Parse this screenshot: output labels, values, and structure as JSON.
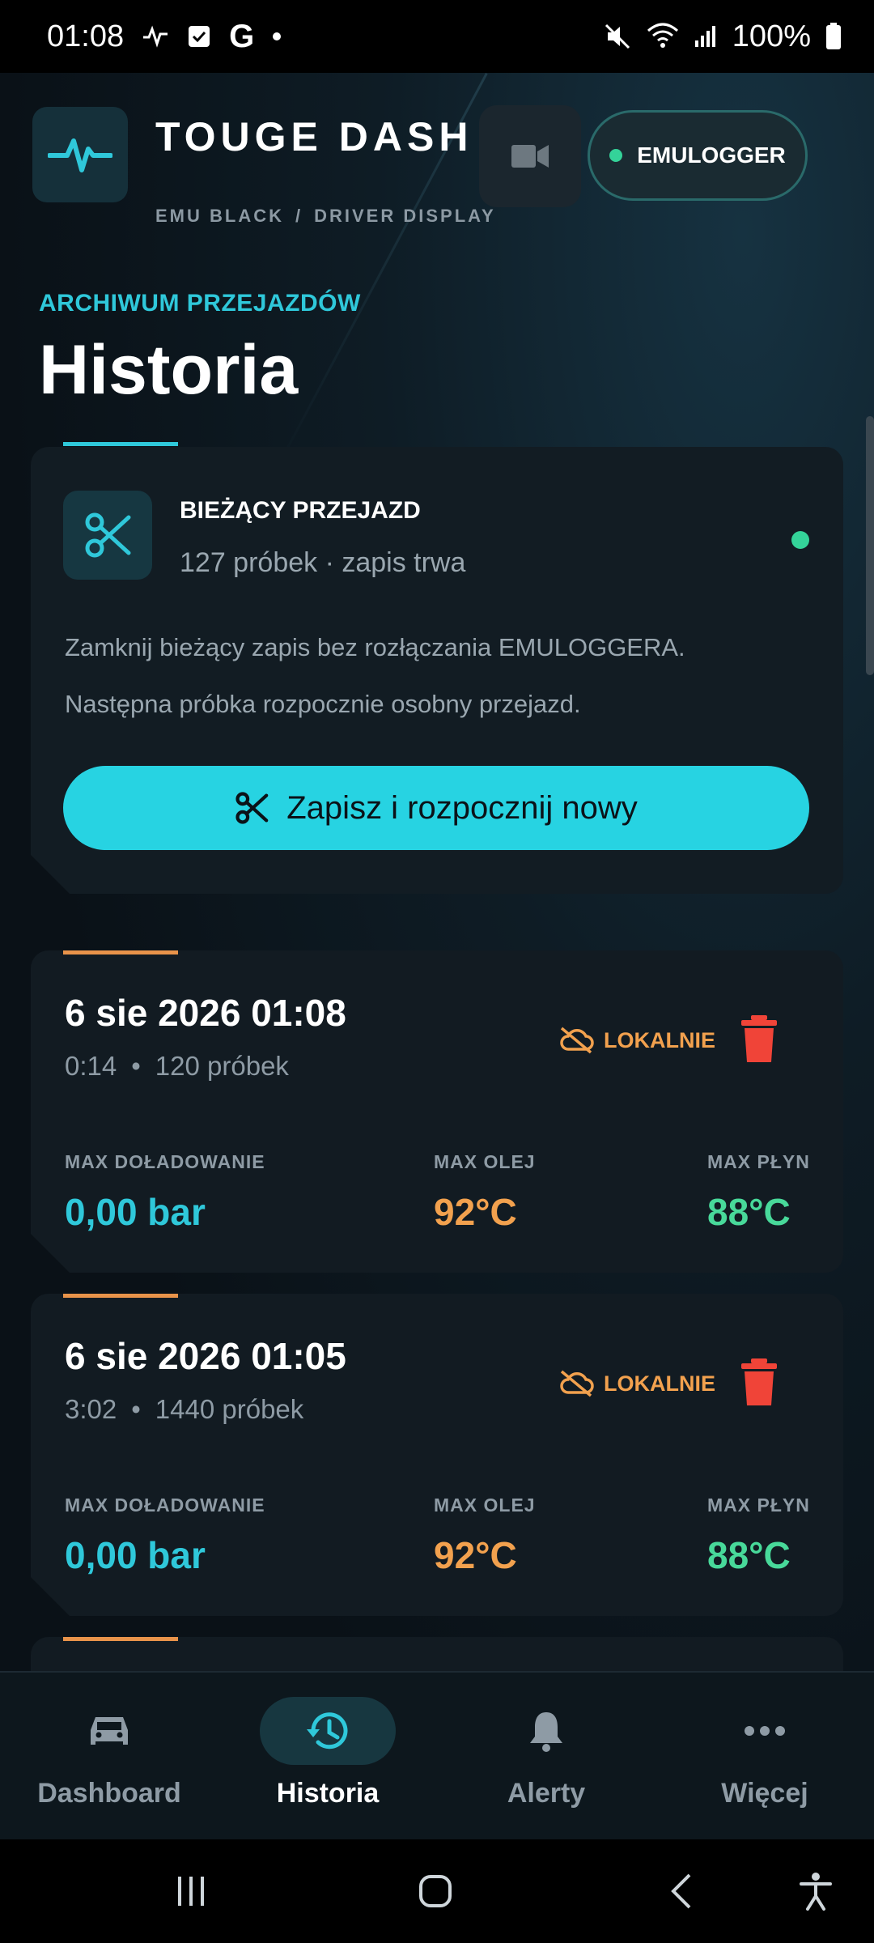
{
  "status_bar": {
    "time": "01:08",
    "battery": "100%",
    "icons_left": [
      "activity-icon",
      "checkbox-icon",
      "google-icon",
      "dot-icon"
    ],
    "icons_right": [
      "mute-icon",
      "wifi-icon",
      "signal-icon",
      "battery-icon"
    ]
  },
  "header": {
    "app_title": "TOUGE DASH",
    "subtitle_left": "EMU BLACK",
    "subtitle_sep": "/",
    "subtitle_right": "DRIVER DISPLAY",
    "connection_label": "EMULOGGER"
  },
  "page": {
    "eyebrow": "ARCHIWUM PRZEJAZDÓW",
    "title": "Historia"
  },
  "current_ride": {
    "title": "BIEŻĄCY PRZEJAZD",
    "subtitle": "127 próbek · zapis trwa",
    "line1": "Zamknij bieżący zapis bez rozłączania EMULOGGERA.",
    "line2": "Następna próbka rozpocznie osobny przejazd.",
    "action_label": "Zapisz i rozpocznij nowy"
  },
  "metric_labels": {
    "boost": "MAX DOŁADOWANIE",
    "oil": "MAX OLEJ",
    "coolant": "MAX PŁYN"
  },
  "sessions": [
    {
      "date": "6 sie 2026 01:08",
      "duration": "0:14",
      "bullet": "•",
      "samples": "120 próbek",
      "storage": "LOKALNIE",
      "boost": "0,00 bar",
      "oil": "92°C",
      "coolant": "88°C"
    },
    {
      "date": "6 sie 2026 01:05",
      "duration": "3:02",
      "bullet": "•",
      "samples": "1440 próbek",
      "storage": "LOKALNIE",
      "boost": "0,00 bar",
      "oil": "92°C",
      "coolant": "88°C"
    }
  ],
  "bottom_nav": [
    {
      "label": "Dashboard",
      "icon": "car-icon",
      "active": false
    },
    {
      "label": "Historia",
      "icon": "history-icon",
      "active": true
    },
    {
      "label": "Alerty",
      "icon": "bell-icon",
      "active": false
    },
    {
      "label": "Więcej",
      "icon": "more-icon",
      "active": false
    }
  ],
  "colors": {
    "accent_cyan": "#27d3e2",
    "accent_orange": "#e8934a",
    "value_green": "#48d99a",
    "danger_red": "#f04438",
    "background": "#0b1218"
  }
}
